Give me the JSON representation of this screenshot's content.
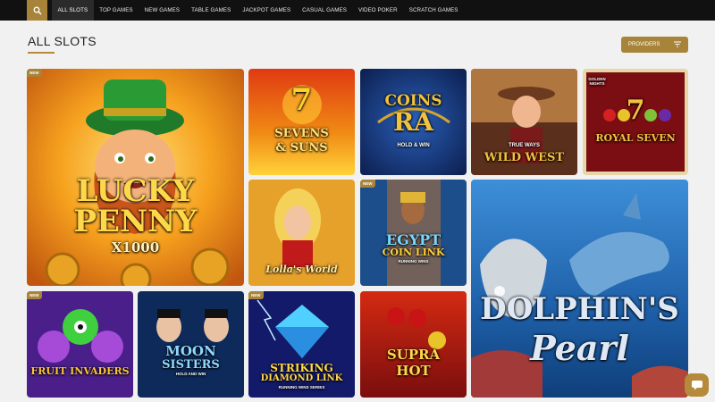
{
  "nav": {
    "items": [
      "ALL SLOTS",
      "TOP GAMES",
      "NEW GAMES",
      "TABLE GAMES",
      "JACKPOT GAMES",
      "CASUAL GAMES",
      "VIDEO POKER",
      "SCRATCH GAMES"
    ],
    "active": "ALL SLOTS"
  },
  "header": {
    "title": "ALL SLOTS",
    "providers_label": "PROVIDERS"
  },
  "badge_text": "NEW",
  "games": {
    "lucky_penny": {
      "line1": "LUCKY",
      "line2": "PENNY",
      "line3": "X1000"
    },
    "sevens_suns": {
      "line1": "7",
      "line2": "SEVENS",
      "line3": "& SUNS"
    },
    "coins_ra": {
      "line1": "COINS",
      "line2": "RA",
      "line3": "HOLD & WIN"
    },
    "wild_west": {
      "line1": "TRUE WAYS",
      "line2": "WILD WEST"
    },
    "royal_seven": {
      "line1": "7",
      "line2": "ROYAL SEVEN",
      "line3": "GOLDEN NIGHTS"
    },
    "lollas_world": {
      "line1": "Lolla's World"
    },
    "egypt_coin_link": {
      "line1": "EGYPT",
      "line2": "COIN LINK",
      "line3": "RUNNING WINS"
    },
    "dolphins_pearl": {
      "line1": "DOLPHIN'S",
      "line2": "Pearl"
    },
    "fruit_invaders": {
      "line1": "FRUIT INVADERS"
    },
    "moon_sisters": {
      "line1": "MOON",
      "line2": "SISTERS",
      "line3": "HOLD AND WIN"
    },
    "striking_diamond_link": {
      "line1": "STRIKING",
      "line2": "DIAMOND LINK",
      "line3": "RUNNING WINS SERIES"
    },
    "supra_hot": {
      "line1": "SUPRA",
      "line2": "HOT"
    }
  },
  "colors": {
    "accent": "#a8843a",
    "nav_bg": "#111111",
    "page_bg": "#f1f1f1"
  }
}
